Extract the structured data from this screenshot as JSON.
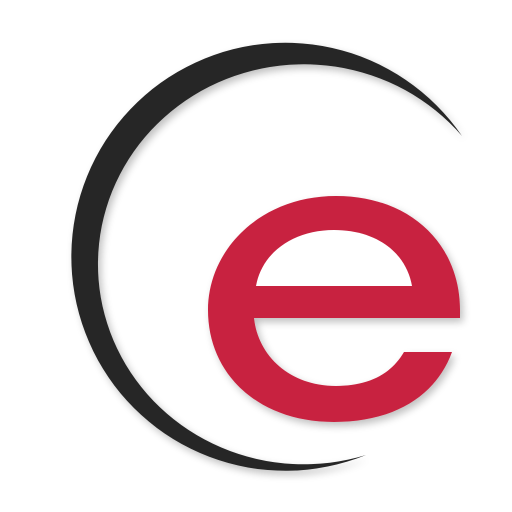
{
  "logo": {
    "name": "e-logo",
    "letter": "e",
    "colors": {
      "background": "#ffffff",
      "arc": "#262626",
      "letter": "#c8233f"
    }
  }
}
